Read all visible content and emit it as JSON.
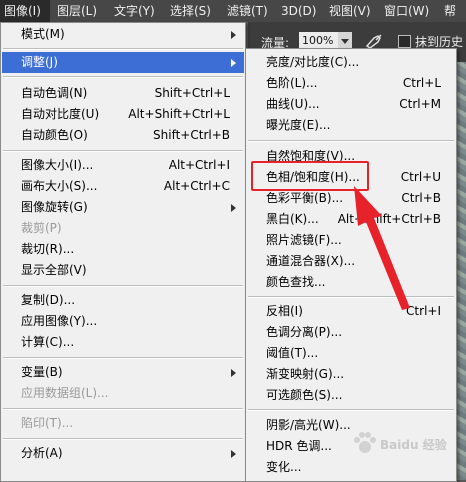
{
  "menubar": {
    "items": [
      {
        "label": "图像(I)",
        "active": true
      },
      {
        "label": "图层(L)"
      },
      {
        "label": "文字(Y)"
      },
      {
        "label": "选择(S)"
      },
      {
        "label": "滤镜(T)"
      },
      {
        "label": "3D(D)"
      },
      {
        "label": "视图(V)"
      },
      {
        "label": "窗口(W)"
      },
      {
        "label": "帮"
      }
    ]
  },
  "options_bar": {
    "flow_label": "流量:",
    "flow_value": "100%",
    "erase_history_label": "抹到历史"
  },
  "image_menu": {
    "items": [
      {
        "label": "模式(M)",
        "submenu": true
      },
      {
        "label": "调整(J)",
        "submenu": true,
        "highlighted": true
      },
      {
        "label": "自动色调(N)",
        "shortcut": "Shift+Ctrl+L"
      },
      {
        "label": "自动对比度(U)",
        "shortcut": "Alt+Shift+Ctrl+L"
      },
      {
        "label": "自动颜色(O)",
        "shortcut": "Shift+Ctrl+B"
      },
      {
        "label": "图像大小(I)...",
        "shortcut": "Alt+Ctrl+I"
      },
      {
        "label": "画布大小(S)...",
        "shortcut": "Alt+Ctrl+C"
      },
      {
        "label": "图像旋转(G)",
        "submenu": true
      },
      {
        "label": "裁剪(P)",
        "disabled": true
      },
      {
        "label": "裁切(R)..."
      },
      {
        "label": "显示全部(V)"
      },
      {
        "label": "复制(D)..."
      },
      {
        "label": "应用图像(Y)..."
      },
      {
        "label": "计算(C)..."
      },
      {
        "label": "变量(B)",
        "submenu": true
      },
      {
        "label": "应用数据组(L)...",
        "disabled": true
      },
      {
        "label": "陷印(T)...",
        "disabled": true
      },
      {
        "label": "分析(A)",
        "submenu": true
      }
    ]
  },
  "adjust_menu": {
    "items": [
      {
        "label": "亮度/对比度(C)..."
      },
      {
        "label": "色阶(L)...",
        "shortcut": "Ctrl+L"
      },
      {
        "label": "曲线(U)...",
        "shortcut": "Ctrl+M"
      },
      {
        "label": "曝光度(E)..."
      },
      {
        "label": "自然饱和度(V)..."
      },
      {
        "label": "色相/饱和度(H)...",
        "shortcut": "Ctrl+U",
        "annotated": true
      },
      {
        "label": "色彩平衡(B)...",
        "shortcut": "Ctrl+B"
      },
      {
        "label": "黑白(K)...",
        "shortcut": "Alt+Shift+Ctrl+B"
      },
      {
        "label": "照片滤镜(F)..."
      },
      {
        "label": "通道混合器(X)..."
      },
      {
        "label": "颜色查找..."
      },
      {
        "label": "反相(I)",
        "shortcut": "Ctrl+I"
      },
      {
        "label": "色调分离(P)..."
      },
      {
        "label": "阈值(T)..."
      },
      {
        "label": "渐变映射(G)..."
      },
      {
        "label": "可选颜色(S)..."
      },
      {
        "label": "阴影/高光(W)..."
      },
      {
        "label": "HDR 色调..."
      },
      {
        "label": "变化..."
      }
    ]
  },
  "watermark": {
    "text": "Baidu 经验"
  },
  "colors": {
    "highlight": "#3c6ed6",
    "annotation": "#e8222a",
    "menu_bg": "#f0f0f0"
  }
}
